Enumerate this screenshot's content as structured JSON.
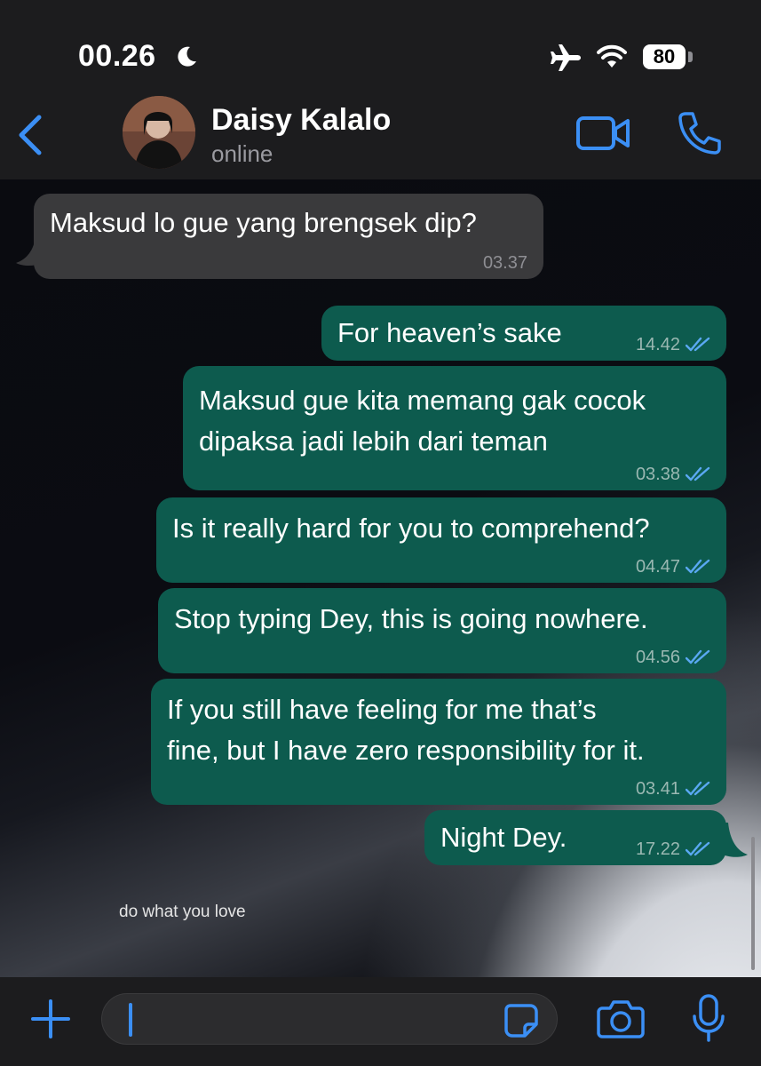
{
  "status_bar": {
    "time": "00.26",
    "battery": "80"
  },
  "header": {
    "contact_name": "Daisy Kalalo",
    "contact_status": "online"
  },
  "messages": [
    {
      "direction": "incoming",
      "text": "Maksud lo gue yang brengsek dip?",
      "time": "03.37"
    },
    {
      "direction": "outgoing",
      "text": "For heaven’s sake",
      "time": "14.42"
    },
    {
      "direction": "outgoing",
      "lines": [
        "Maksud gue kita memang gak cocok",
        "dipaksa jadi lebih dari teman"
      ],
      "time": "03.38"
    },
    {
      "direction": "outgoing",
      "text": "Is it really hard for you to comprehend?",
      "time": "04.47"
    },
    {
      "direction": "outgoing",
      "text": "Stop typing Dey, this is going nowhere.",
      "time": "04.56"
    },
    {
      "direction": "outgoing",
      "lines": [
        "If you still have feeling for me that’s",
        "fine, but I have zero responsibility for it."
      ],
      "time": "03.41"
    },
    {
      "direction": "outgoing",
      "text": "Night Dey.",
      "time": "17.22"
    }
  ],
  "wallpaper_text": "do what you love",
  "colors": {
    "accent": "#3b8ff5",
    "outgoing_bubble": "#0d5b4e",
    "incoming_bubble": "#3a3a3c",
    "bar_background": "#1c1c1e"
  },
  "icons": [
    "moon-icon",
    "airplane-icon",
    "wifi-icon",
    "back-chevron-icon",
    "video-call-icon",
    "phone-call-icon",
    "double-check-icon",
    "plus-icon",
    "sticker-icon",
    "camera-icon",
    "microphone-icon"
  ]
}
